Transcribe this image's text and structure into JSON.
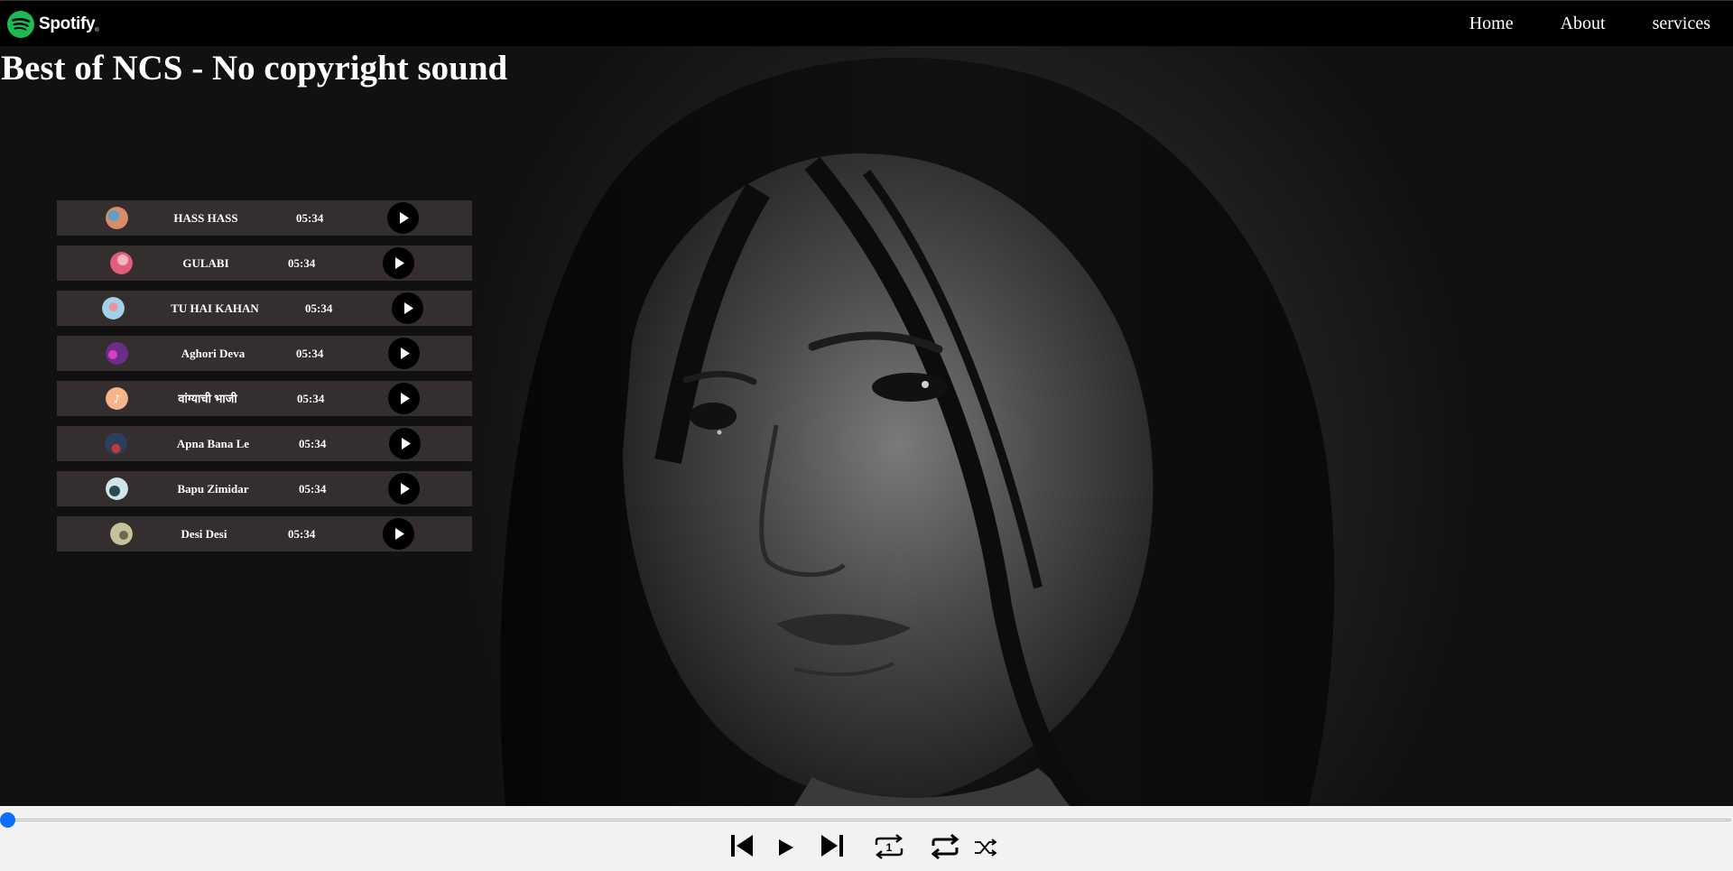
{
  "brand": {
    "name": "Spotify",
    "tm": "®",
    "color": "#1DB954"
  },
  "nav": {
    "home": "Home",
    "about": "About",
    "services": "services"
  },
  "title": "Best of NCS - No copyright sound",
  "songs": [
    {
      "name": "HASS HASS",
      "duration": "05:34",
      "cover_color": "#d98c6a",
      "cover_accent": "#5aa0c8"
    },
    {
      "name": "GULABI",
      "duration": "05:34",
      "cover_color": "#e25d7a",
      "cover_accent": "#f3b6c2"
    },
    {
      "name": "TU HAI KAHAN",
      "duration": "05:34",
      "cover_color": "#9fd3ea",
      "cover_accent": "#f08fa0"
    },
    {
      "name": "Aghori Deva",
      "duration": "05:34",
      "cover_color": "#6b2d8a",
      "cover_accent": "#e03cbf"
    },
    {
      "name": "वांग्याची भाजी",
      "duration": "05:34",
      "cover_color": "#f6b48a",
      "cover_accent": "#ffffff"
    },
    {
      "name": "Apna Bana Le",
      "duration": "05:34",
      "cover_color": "#2c3e5c",
      "cover_accent": "#c23a3a"
    },
    {
      "name": "Bapu Zimidar",
      "duration": "05:34",
      "cover_color": "#cfe6e8",
      "cover_accent": "#2d4b4f"
    },
    {
      "name": "Desi Desi",
      "duration": "05:34",
      "cover_color": "#c8c29a",
      "cover_accent": "#6c6a4e"
    }
  ],
  "player": {
    "progress_percent": 0,
    "accent": "#0d6efd",
    "icons": [
      "skip-back-icon",
      "play-icon",
      "skip-forward-icon",
      "repeat-one-icon",
      "repeat-icon",
      "shuffle-icon"
    ]
  }
}
